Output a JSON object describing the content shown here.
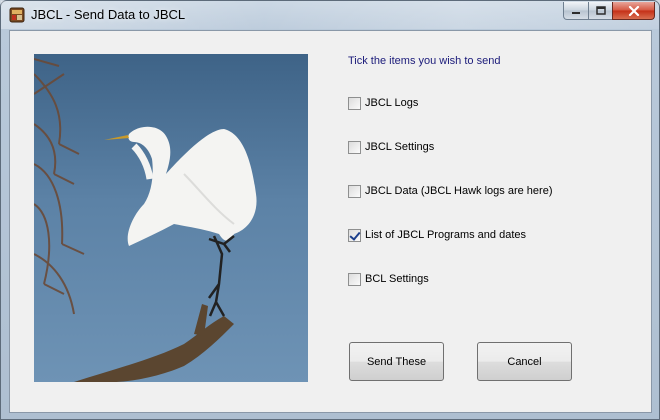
{
  "window": {
    "title": "JBCL - Send Data to JBCL",
    "icon": "jbcl-app-icon",
    "controls": [
      "minimize-icon",
      "maximize-icon",
      "close-icon"
    ]
  },
  "image": {
    "description": "egret-photo"
  },
  "form": {
    "instruction": "Tick the items you wish to send",
    "options": [
      {
        "label": "JBCL Logs",
        "checked": false
      },
      {
        "label": "JBCL Settings",
        "checked": false
      },
      {
        "label": "JBCL Data (JBCL Hawk logs are here)",
        "checked": false
      },
      {
        "label": "List of JBCL Programs and dates",
        "checked": true
      },
      {
        "label": "BCL Settings",
        "checked": false
      }
    ]
  },
  "buttons": {
    "send_label": "Send These",
    "cancel_label": "Cancel"
  },
  "colors": {
    "instruction_text": "#1b1b7a",
    "close_button": "#c42f16"
  }
}
